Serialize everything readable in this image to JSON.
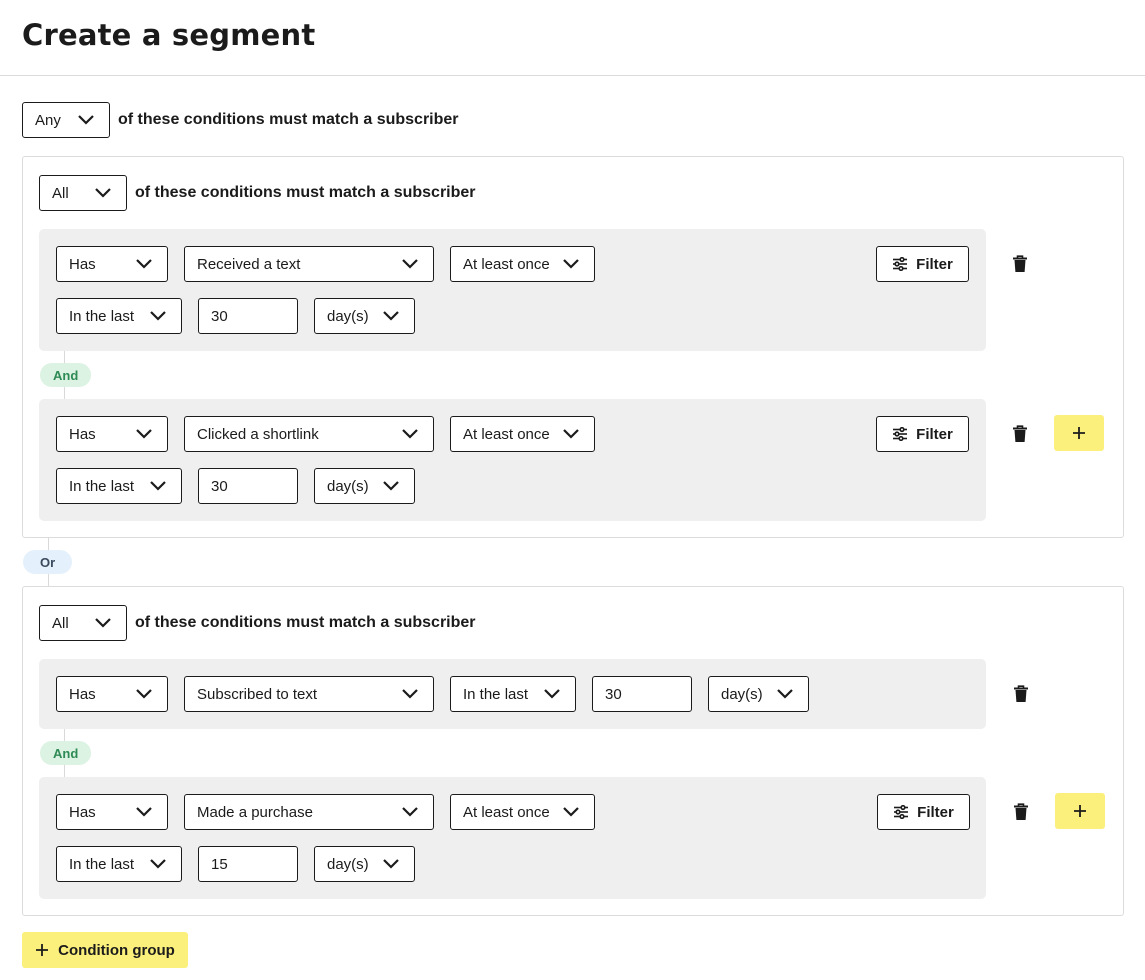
{
  "page": {
    "title": "Create a segment"
  },
  "root": {
    "match": "Any",
    "condition_text": "of these conditions must match a subscriber"
  },
  "groups": [
    {
      "match": "All",
      "condition_text": "of these conditions must match a subscriber",
      "rows": [
        {
          "has": "Has",
          "event": "Received a text",
          "frequency": "At least once",
          "window": "In the last",
          "amount": "30",
          "unit": "day(s)",
          "filter_label": "Filter"
        },
        {
          "has": "Has",
          "event": "Clicked a shortlink",
          "frequency": "At least once",
          "window": "In the last",
          "amount": "30",
          "unit": "day(s)",
          "filter_label": "Filter"
        }
      ],
      "connector": "And"
    },
    {
      "match": "All",
      "condition_text": "of these conditions must match a subscriber",
      "rows": [
        {
          "has": "Has",
          "event": "Subscribed to text",
          "window": "In the last",
          "amount": "30",
          "unit": "day(s)"
        },
        {
          "has": "Has",
          "event": "Made a purchase",
          "frequency": "At least once",
          "window": "In the last",
          "amount": "15",
          "unit": "day(s)",
          "filter_label": "Filter"
        }
      ],
      "connector": "And"
    }
  ],
  "group_connector": "Or",
  "add_group_label": "Condition group",
  "colors": {
    "accent_yellow": "#fcf07c",
    "and_badge": "#dcf2e3",
    "or_badge": "#e4f0fb",
    "row_bg": "#efefef"
  }
}
